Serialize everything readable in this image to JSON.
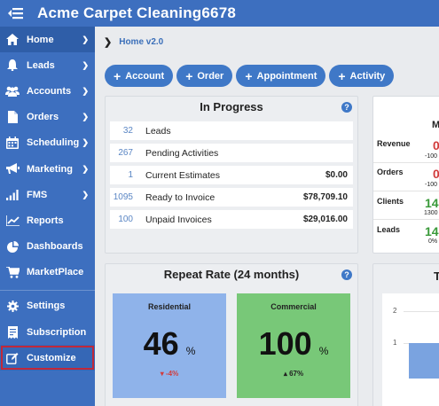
{
  "header": {
    "title": "Acme Carpet Cleaning6678"
  },
  "sidebar": {
    "items": [
      {
        "label": "Home",
        "icon": "home-icon",
        "has_chevron": true,
        "active": true
      },
      {
        "label": "Leads",
        "icon": "bell-icon",
        "has_chevron": true
      },
      {
        "label": "Accounts",
        "icon": "users-icon",
        "has_chevron": true
      },
      {
        "label": "Orders",
        "icon": "document-icon",
        "has_chevron": true
      },
      {
        "label": "Scheduling",
        "icon": "calendar-icon",
        "has_chevron": true
      },
      {
        "label": "Marketing",
        "icon": "megaphone-icon",
        "has_chevron": true
      },
      {
        "label": "FMS",
        "icon": "signal-bars-icon",
        "has_chevron": true
      },
      {
        "label": "Reports",
        "icon": "line-chart-icon",
        "has_chevron": false
      },
      {
        "label": "Dashboards",
        "icon": "pie-chart-icon",
        "has_chevron": false
      },
      {
        "label": "MarketPlace",
        "icon": "cart-icon",
        "has_chevron": false
      }
    ],
    "bottom_items": [
      {
        "label": "Settings",
        "icon": "gear-icon"
      },
      {
        "label": "Subscription",
        "icon": "receipt-icon"
      },
      {
        "label": "Customize",
        "icon": "edit-icon"
      }
    ]
  },
  "breadcrumb": {
    "current": "Home v2.0"
  },
  "actions": [
    "Account",
    "Order",
    "Appointment",
    "Activity"
  ],
  "in_progress": {
    "title": "In Progress",
    "rows": [
      {
        "num": "32",
        "label": "Leads",
        "amount": ""
      },
      {
        "num": "267",
        "label": "Pending Activities",
        "amount": ""
      },
      {
        "num": "1",
        "label": "Current Estimates",
        "amount": "$0.00"
      },
      {
        "num": "1095",
        "label": "Ready to Invoice",
        "amount": "$78,709.10"
      },
      {
        "num": "100",
        "label": "Unpaid Invoices",
        "amount": "$29,016.00"
      }
    ]
  },
  "repeat_rate": {
    "title": "Repeat Rate (24 months)",
    "residential": {
      "label": "Residential",
      "value": "46",
      "unit": "%",
      "delta": "-4%",
      "color": "#8fb3ea",
      "delta_color": "#d23c3c"
    },
    "commercial": {
      "label": "Commercial",
      "value": "100",
      "unit": "%",
      "delta": "67%",
      "color": "#78c878",
      "delta_color": "#222222"
    }
  },
  "right_card": {
    "header_partial": "M",
    "rows": [
      {
        "label": "Revenue",
        "value": "0",
        "sub": "-100",
        "color": "#d23c3c"
      },
      {
        "label": "Orders",
        "value": "0",
        "sub": "-100",
        "color": "#d23c3c"
      },
      {
        "label": "Clients",
        "value": "14",
        "sub": "1300",
        "color": "#3a9a3a"
      },
      {
        "label": "Leads",
        "value": "14",
        "sub": "0%",
        "color": "#3a9a3a"
      }
    ]
  },
  "chart_card": {
    "title_partial": "T",
    "y_ticks": [
      "2",
      "1"
    ]
  },
  "colors": {
    "brand": "#3d6fbf",
    "action_button": "#3f78c7",
    "highlight_outline": "#c0283a"
  }
}
